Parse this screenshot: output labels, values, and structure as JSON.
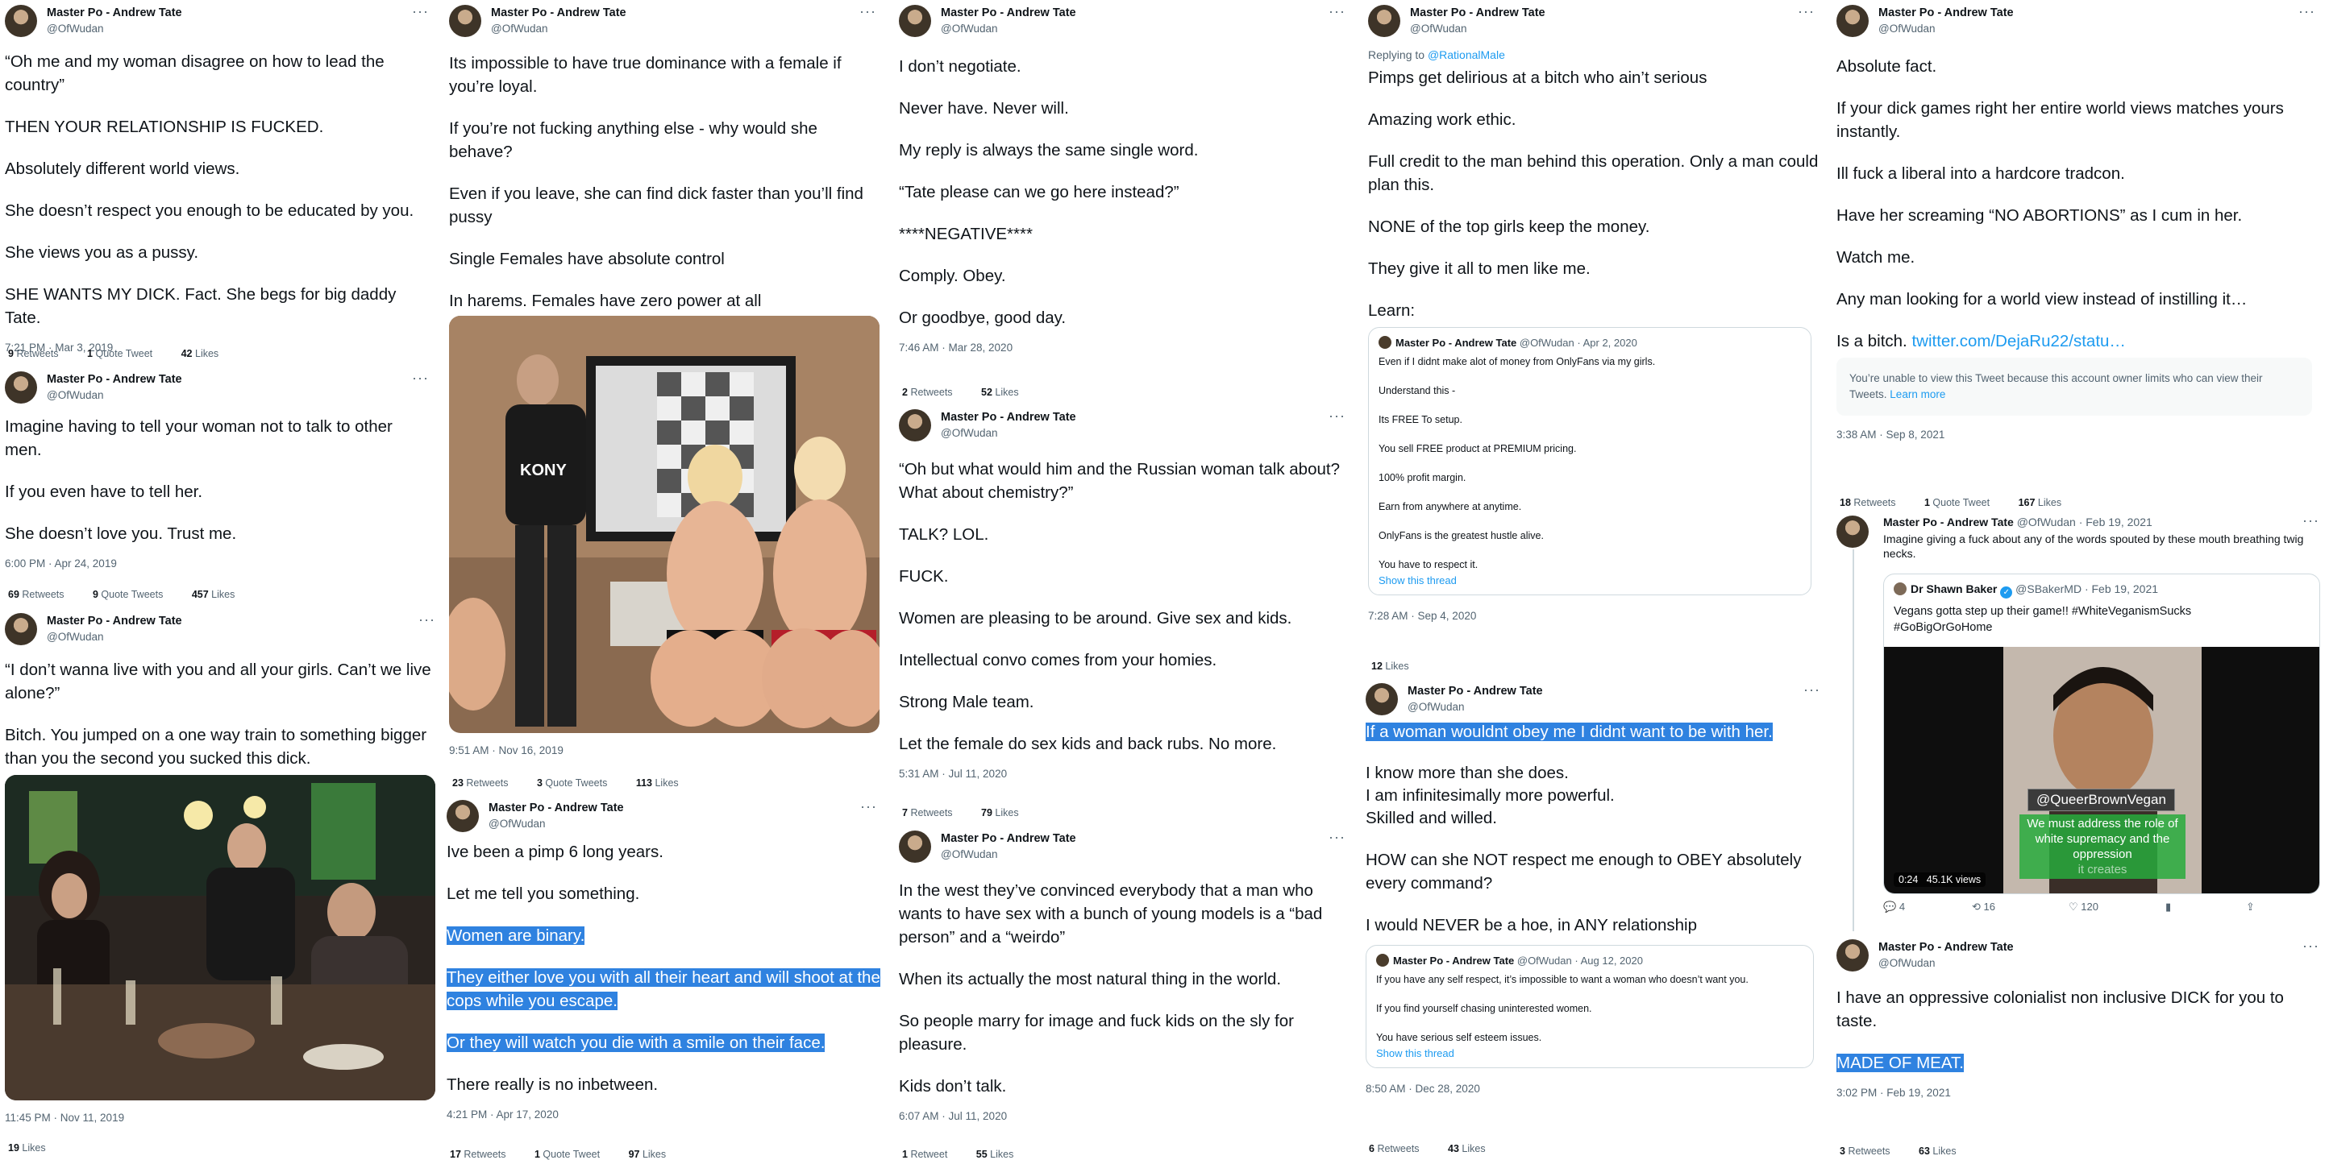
{
  "author": {
    "name": "Master Po - Andrew Tate",
    "handle": "@OfWudan"
  },
  "more_glyph": "···",
  "tweets": {
    "c1t1": {
      "p": [
        "“Oh me and my woman disagree on how to lead the country”",
        "THEN YOUR RELATIONSHIP IS FUCKED.",
        "Absolutely different world views.",
        "She doesn’t respect you enough to be educated by you.",
        "She views you as a pussy.",
        "SHE WANTS MY DICK. Fact. She begs for big daddy Tate."
      ],
      "meta": "7:21 PM · Mar 3, 2019",
      "stats": {
        "retweets": "9",
        "retweets_label": "Retweets",
        "quotes": "1",
        "quotes_label": "Quote Tweet",
        "likes": "42",
        "likes_label": "Likes"
      }
    },
    "c1t2": {
      "p": [
        "Imagine having to tell your woman not to talk to other men.",
        "If you even have to tell her.",
        "She doesn’t love you. Trust me."
      ],
      "meta": "6:00 PM · Apr 24, 2019",
      "stats": {
        "retweets": "69",
        "retweets_label": "Retweets",
        "quotes": "9",
        "quotes_label": "Quote Tweets",
        "likes": "457",
        "likes_label": "Likes"
      }
    },
    "c1t3": {
      "p": [
        "“I don’t wanna live with you and all your girls. Can’t we live alone?”",
        "Bitch. You jumped on a one way train to something bigger than you the second you sucked this dick."
      ],
      "meta": "11:45 PM · Nov 11, 2019",
      "stats": {
        "likes": "19",
        "likes_label": "Likes"
      }
    },
    "c2t1": {
      "p": [
        "Its impossible to have true dominance with a female if you’re loyal.",
        "If you’re not fucking anything else - why would she behave?",
        "Even if you leave, she can find dick faster than you’ll find pussy",
        "Single Females have absolute control",
        "In harems. Females have zero power at all"
      ],
      "photo_shirt": "KONY",
      "meta": "9:51 AM · Nov 16, 2019",
      "stats": {
        "retweets": "23",
        "retweets_label": "Retweets",
        "quotes": "3",
        "quotes_label": "Quote Tweets",
        "likes": "113",
        "likes_label": "Likes"
      }
    },
    "c2t2": {
      "p": [
        "Ive been a pimp 6 long years.",
        "Let me tell you something."
      ],
      "hl": [
        "Women are binary.",
        "They either love you with all their heart and will shoot at the cops while you escape.",
        "Or they will watch you die with a smile on their face."
      ],
      "p2": "There really is no inbetween.",
      "meta": "4:21 PM · Apr 17, 2020",
      "stats": {
        "retweets": "17",
        "retweets_label": "Retweets",
        "quotes": "1",
        "quotes_label": "Quote Tweet",
        "likes": "97",
        "likes_label": "Likes"
      }
    },
    "c3t1": {
      "p": [
        "I don’t negotiate.",
        "Never have. Never will.",
        "My reply is always the same single word.",
        "“Tate please can we go here instead?”",
        "****NEGATIVE****",
        "Comply. Obey.",
        "Or goodbye, good day."
      ],
      "meta": "7:46 AM · Mar 28, 2020",
      "stats": {
        "retweets": "2",
        "retweets_label": "Retweets",
        "likes": "52",
        "likes_label": "Likes"
      }
    },
    "c3t2": {
      "p": [
        "“Oh but what would him and the Russian woman talk about? What about chemistry?”",
        "TALK? LOL.",
        "FUCK.",
        "Women are pleasing to be around. Give sex and kids.",
        "Intellectual convo comes from your homies.",
        "Strong Male team.",
        "Let the female do sex kids and back rubs. No more."
      ],
      "meta": "5:31 AM · Jul 11, 2020",
      "stats": {
        "retweets": "7",
        "retweets_label": "Retweets",
        "likes": "79",
        "likes_label": "Likes"
      }
    },
    "c3t3": {
      "p": [
        "In the west they’ve convinced everybody that a man who wants to have sex with a bunch of young models is a “bad person” and a “weirdo”",
        "When its actually the most natural thing in the world.",
        "So people marry for image and fuck kids on the sly for pleasure.",
        "Kids don’t talk."
      ],
      "meta": "6:07 AM · Jul 11, 2020",
      "stats": {
        "retweets": "1",
        "retweets_label": "Retweet",
        "likes": "55",
        "likes_label": "Likes"
      }
    },
    "c4t1": {
      "replying_prefix": "Replying to",
      "replying_to": "@RationalMale",
      "p": [
        "Pimps get delirious at a bitch who ain’t serious",
        "Amazing work ethic.",
        "Full credit to the man behind this operation. Only a man could plan this.",
        "NONE of the top girls keep the money.",
        "They give it all to men like me.",
        "Learn:"
      ],
      "quote": {
        "date": "· Apr 2, 2020",
        "p": [
          "Even if I didnt make alot of money from OnlyFans via my girls.",
          "Understand this -",
          "Its FREE To setup.",
          "You sell FREE product at PREMIUM pricing.",
          "100% profit margin.",
          "Earn from anywhere at anytime.",
          "OnlyFans is the greatest hustle alive.",
          "You have to respect it."
        ],
        "show": "Show this thread"
      },
      "meta": "7:28 AM · Sep 4, 2020",
      "stats": {
        "likes": "12",
        "likes_label": "Likes"
      }
    },
    "c4t2": {
      "hl": "If a woman wouldnt obey me I didnt want to be with her.",
      "p": [
        "I know more than she does.\nI am infinitesimally more powerful.\nSkilled and willed.",
        "HOW can she NOT respect me enough to OBEY absolutely every command?",
        "I would NEVER be a hoe, in ANY relationship"
      ],
      "quote": {
        "date": "· Aug 12, 2020",
        "p": [
          "If you have any self respect, it’s impossible to want a woman who doesn’t want you.",
          "If you find yourself chasing uninterested women.",
          "You have serious self esteem issues."
        ],
        "show": "Show this thread"
      },
      "meta": "8:50 AM · Dec 28, 2020",
      "stats": {
        "retweets": "6",
        "retweets_label": "Retweets",
        "likes": "43",
        "likes_label": "Likes"
      }
    },
    "c5t1": {
      "p": [
        "Absolute fact.",
        "If your dick games right her entire world views matches yours instantly.",
        "Ill fuck a liberal into a hardcore tradcon.",
        "Have her screaming “NO ABORTIONS” as I cum in her.",
        "Watch me.",
        "Any man looking for a world view instead of instilling it…"
      ],
      "last_prefix": "Is a bitch.",
      "last_link": "twitter.com/DejaRu22/statu…",
      "notice": "You’re unable to view this Tweet because this account owner limits who can view their Tweets.",
      "notice_link": "Learn more",
      "meta": "3:38 AM · Sep 8, 2021",
      "stats": {
        "retweets": "18",
        "retweets_label": "Retweets",
        "quotes": "1",
        "quotes_label": "Quote Tweet",
        "likes": "167",
        "likes_label": "Likes"
      }
    },
    "c5t2": {
      "date": "· Feb 19, 2021",
      "p": "Imagine giving a fuck about any of the words spouted by these mouth breathing twig necks.",
      "quote": {
        "name": "Dr Shawn Baker",
        "handle": "@SBakerMD",
        "date": "· Feb 19, 2021",
        "text": "Vegans gotta step up their game!! #WhiteVeganismSucks #GoBigOrGoHome",
        "video_tag": "@QueerBrownVegan",
        "caption": "We must address the role of white supremacy and the oppression",
        "caption2": "it creates",
        "time": "0:24",
        "views": "45.1K views"
      },
      "actions": {
        "replies": "4",
        "retweets": "16",
        "likes": "120"
      }
    },
    "c5t3": {
      "p": "I have an oppressive colonialist non inclusive DICK for you to taste.",
      "hl": "MADE OF MEAT.",
      "meta": "3:02 PM · Feb 19, 2021",
      "stats": {
        "retweets": "3",
        "retweets_label": "Retweets",
        "likes": "63",
        "likes_label": "Likes"
      }
    }
  }
}
